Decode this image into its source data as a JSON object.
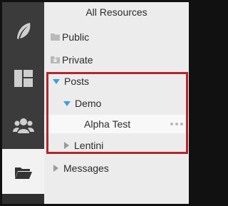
{
  "panel": {
    "title": "All Resources"
  },
  "rail": {
    "items": [
      {
        "icon": "feather-icon"
      },
      {
        "icon": "dashboard-icon"
      },
      {
        "icon": "users-icon"
      },
      {
        "icon": "folder-open-icon",
        "active": true
      }
    ]
  },
  "tree": {
    "public": {
      "label": "Public",
      "icon": "folder-icon"
    },
    "private": {
      "label": "Private",
      "icon": "lock-folder-icon"
    },
    "posts": {
      "label": "Posts",
      "expanded": true
    },
    "demo": {
      "label": "Demo",
      "expanded": true
    },
    "alpha_test": {
      "label": "Alpha Test",
      "selected": true
    },
    "lentini": {
      "label": "Lentini",
      "expanded": false
    },
    "messages": {
      "label": "Messages",
      "expanded": false
    }
  },
  "colors": {
    "rail_bg": "#3b3b3b",
    "panel_bg": "#ececec",
    "caret_expanded": "#3aa0dc",
    "highlight_border": "#b3262c"
  }
}
